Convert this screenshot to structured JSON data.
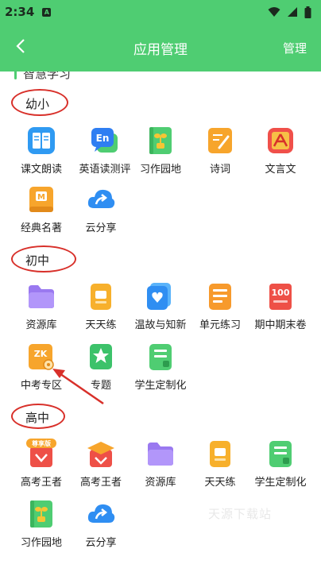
{
  "status": {
    "time": "2:34",
    "notif_letter": "A"
  },
  "header": {
    "title": "应用管理",
    "manage_label": "管理"
  },
  "top_section": {
    "title": "智慧学习"
  },
  "sections": [
    {
      "label": "幼小",
      "apps": [
        "课文朗读",
        "英语读测评",
        "习作园地",
        "诗词",
        "文言文",
        "经典名著",
        "云分享"
      ]
    },
    {
      "label": "初中",
      "apps": [
        "资源库",
        "天天练",
        "温故与知新",
        "单元练习",
        "期中期末卷",
        "中考专区",
        "专题",
        "学生定制化"
      ]
    },
    {
      "label": "高中",
      "apps": [
        "高考王者",
        "高考王者",
        "资源库",
        "天天练",
        "学生定制化",
        "习作园地",
        "云分享"
      ]
    }
  ],
  "icon_text": {
    "en": "En",
    "zk": "ZK",
    "hundred": "100",
    "premium": "尊享版",
    "m": "M"
  },
  "watermark": "天源下载站",
  "colors": {
    "brand_green": "#4fcd72",
    "annotation_red": "#d8302a"
  }
}
